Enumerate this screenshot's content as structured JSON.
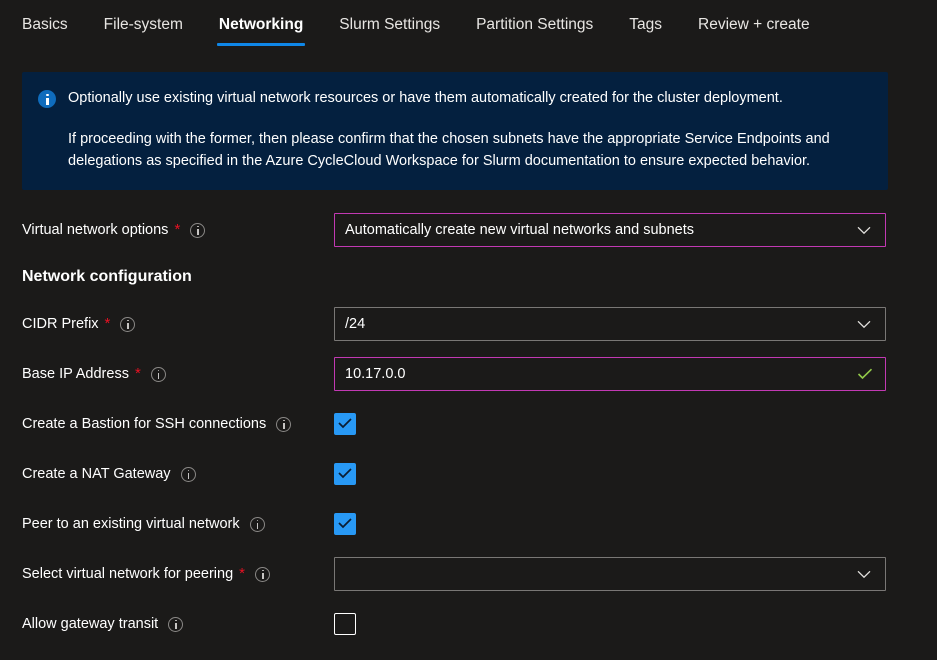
{
  "tabs": [
    {
      "label": "Basics",
      "active": false
    },
    {
      "label": "File-system",
      "active": false
    },
    {
      "label": "Networking",
      "active": true
    },
    {
      "label": "Slurm Settings",
      "active": false
    },
    {
      "label": "Partition Settings",
      "active": false
    },
    {
      "label": "Tags",
      "active": false
    },
    {
      "label": "Review + create",
      "active": false
    }
  ],
  "banner": {
    "icon": "info-icon",
    "line1": "Optionally use existing virtual network resources or have them automatically created for the cluster deployment.",
    "line2": "If proceeding with the former, then please confirm that the chosen subnets have the appropriate Service Endpoints and delegations as specified in the Azure CycleCloud Workspace for Slurm documentation to ensure expected behavior.",
    "background_color": "#04203f",
    "icon_color": "#0f6cbd"
  },
  "form": {
    "virtual_network_options": {
      "label": "Virtual network options",
      "required": true,
      "value": "Automatically create new virtual networks and subnets",
      "control": "dropdown",
      "focused": true
    },
    "section_heading": "Network configuration",
    "cidr_prefix": {
      "label": "CIDR Prefix",
      "required": true,
      "value": "/24",
      "control": "dropdown",
      "focused": false
    },
    "base_ip_address": {
      "label": "Base IP Address",
      "required": true,
      "value": "10.17.0.0",
      "control": "textbox",
      "focused": true,
      "validated": true
    },
    "create_bastion": {
      "label": "Create a Bastion for SSH connections",
      "required": false,
      "control": "checkbox",
      "checked": true
    },
    "create_nat_gateway": {
      "label": "Create a NAT Gateway",
      "required": false,
      "control": "checkbox",
      "checked": true
    },
    "peer_existing_vnet": {
      "label": "Peer to an existing virtual network",
      "required": false,
      "control": "checkbox",
      "checked": true
    },
    "select_vnet_peering": {
      "label": "Select virtual network for peering",
      "required": true,
      "value": "",
      "control": "dropdown",
      "focused": false
    },
    "allow_gateway_transit": {
      "label": "Allow gateway transit",
      "required": false,
      "control": "checkbox",
      "checked": false
    }
  },
  "colors": {
    "page_background": "#1b1a19",
    "accent_blue": "#0f87e8",
    "focus_magenta": "#c239b3",
    "required_red": "#e81123",
    "checkbox_blue": "#2899f5",
    "valid_green": "#92c949",
    "border_gray": "#797775"
  }
}
